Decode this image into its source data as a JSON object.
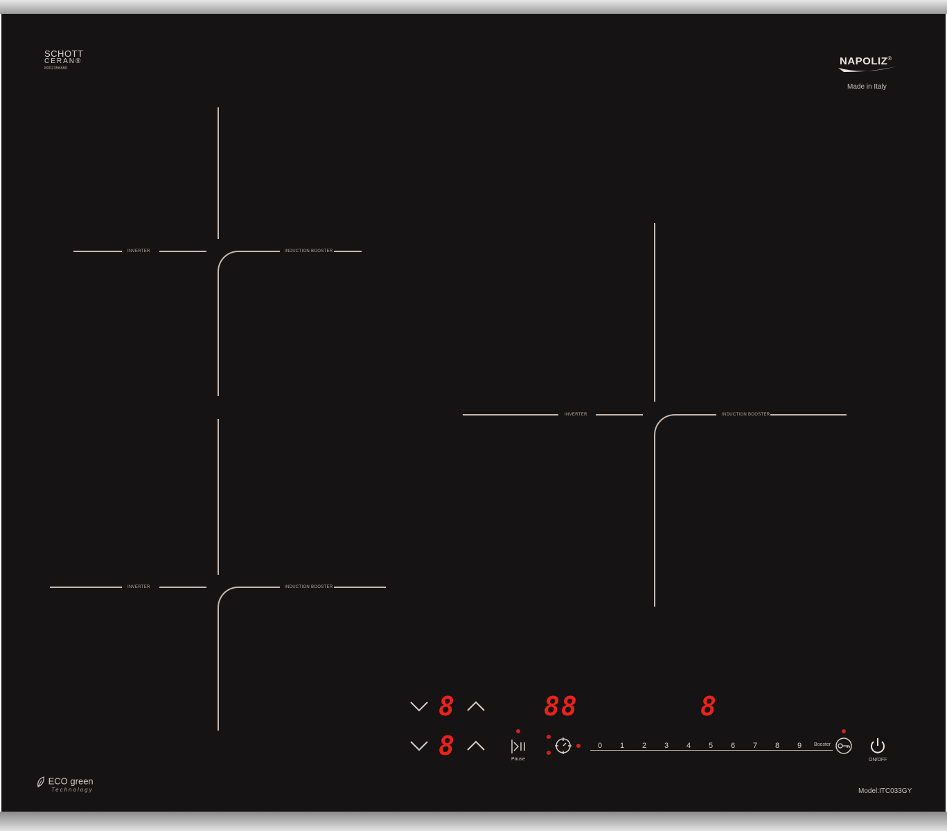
{
  "brand": {
    "schott_line1": "SCHOTT",
    "schott_line2": "CERAN®",
    "schott_code": "8002356860",
    "napoliz": "NAPOLIZ",
    "napoliz_mark": "®",
    "made_in": "Made in Italy"
  },
  "zones": [
    {
      "left_label": "INVERTER",
      "right_label": "INDUCTION BOOSTER"
    },
    {
      "left_label": "INVERTER",
      "right_label": "INDUCTION BOOSTER"
    },
    {
      "left_label": "INVERTER",
      "right_label": "INDUCTION BOOSTER"
    }
  ],
  "eco": {
    "title": "ECO green",
    "subtitle": "Technology"
  },
  "model": "Model:ITC033GY",
  "controls": {
    "zone_top_digit": "8",
    "zone_bottom_digit": "8",
    "timer_digits": "88",
    "power_digit": "8",
    "pause_label": "Pause",
    "slider_levels": [
      "0",
      "1",
      "2",
      "3",
      "4",
      "5",
      "6",
      "7",
      "8",
      "9"
    ],
    "booster_label": "Booster",
    "onoff_label": "ON/OFF"
  },
  "colors": {
    "glass": "#151313",
    "lines": "#c8b8b0",
    "display_red": "#e8231b"
  },
  "icons": [
    "leaf-icon",
    "chevron-down-icon",
    "chevron-up-icon",
    "pause-icon",
    "timer-icon",
    "key-lock-icon",
    "power-icon"
  ]
}
